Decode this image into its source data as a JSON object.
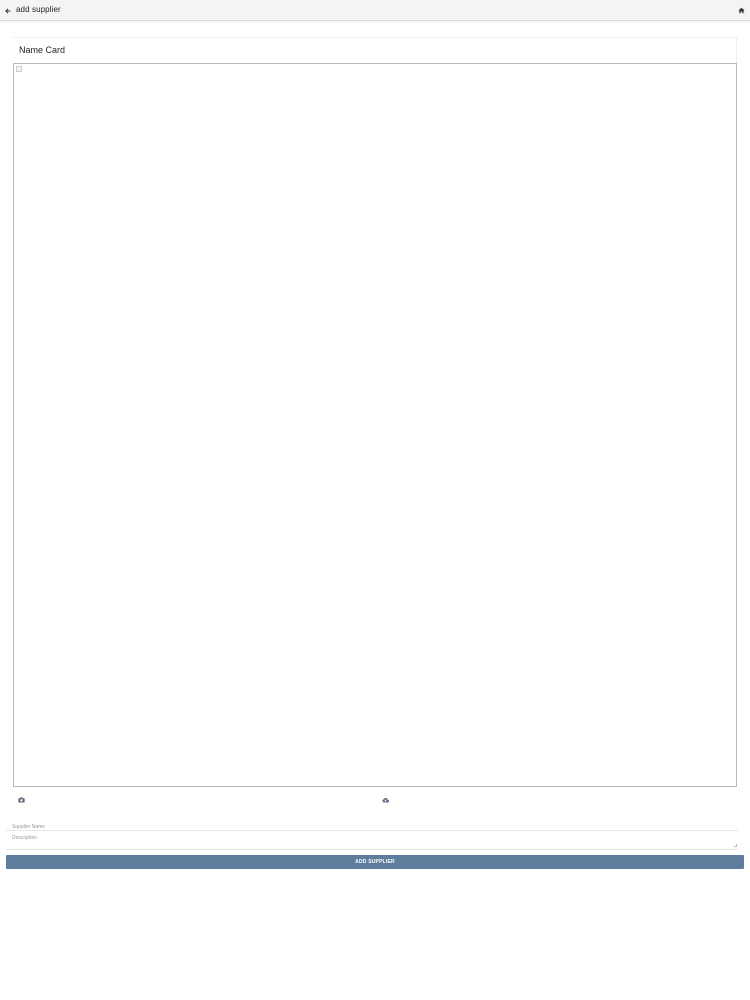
{
  "appbar": {
    "title": "add supplier",
    "back_icon": "arrow-left-icon",
    "home_icon": "home-icon"
  },
  "card": {
    "title": "Name Card"
  },
  "photo_actions": {
    "camera_icon": "camera-icon",
    "upload_icon": "cloud-upload-icon"
  },
  "form": {
    "supplier_name_placeholder": "Supplier Name",
    "supplier_name_value": "",
    "description_placeholder": "Description",
    "description_value": "",
    "submit_label": "ADD SUPPLIER"
  },
  "colors": {
    "appbar_bg": "#f4f3f5",
    "button_bg": "#5e7d9d",
    "button_text": "#ffffff"
  }
}
